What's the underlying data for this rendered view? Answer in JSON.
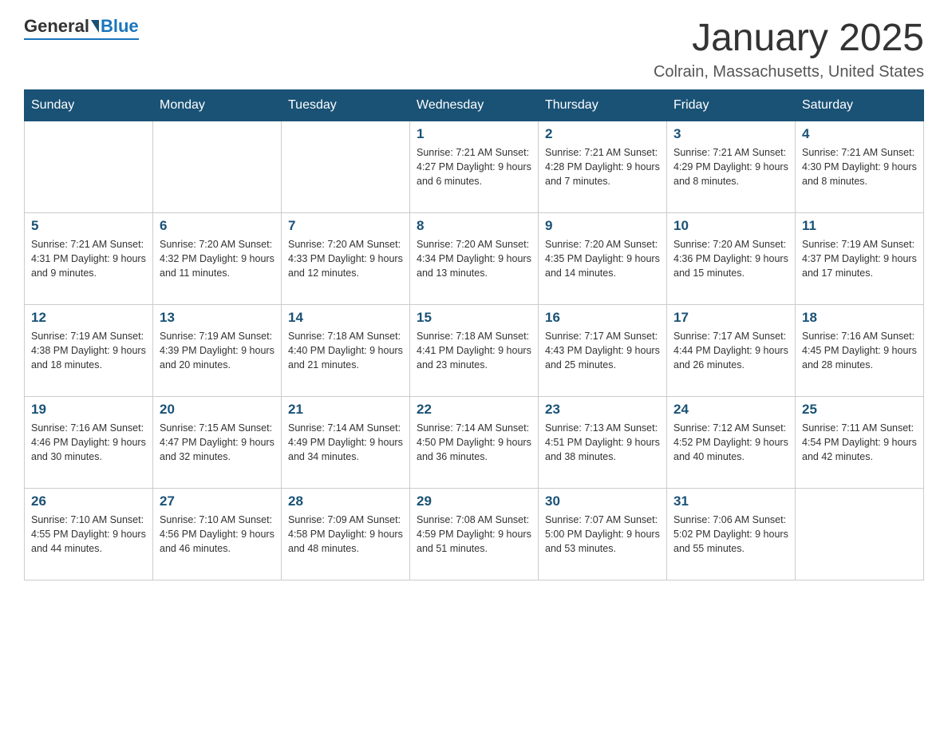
{
  "header": {
    "logo_general": "General",
    "logo_blue": "Blue",
    "month_title": "January 2025",
    "location": "Colrain, Massachusetts, United States"
  },
  "days_of_week": [
    "Sunday",
    "Monday",
    "Tuesday",
    "Wednesday",
    "Thursday",
    "Friday",
    "Saturday"
  ],
  "weeks": [
    [
      {
        "day": "",
        "info": ""
      },
      {
        "day": "",
        "info": ""
      },
      {
        "day": "",
        "info": ""
      },
      {
        "day": "1",
        "info": "Sunrise: 7:21 AM\nSunset: 4:27 PM\nDaylight: 9 hours and 6 minutes."
      },
      {
        "day": "2",
        "info": "Sunrise: 7:21 AM\nSunset: 4:28 PM\nDaylight: 9 hours and 7 minutes."
      },
      {
        "day": "3",
        "info": "Sunrise: 7:21 AM\nSunset: 4:29 PM\nDaylight: 9 hours and 8 minutes."
      },
      {
        "day": "4",
        "info": "Sunrise: 7:21 AM\nSunset: 4:30 PM\nDaylight: 9 hours and 8 minutes."
      }
    ],
    [
      {
        "day": "5",
        "info": "Sunrise: 7:21 AM\nSunset: 4:31 PM\nDaylight: 9 hours and 9 minutes."
      },
      {
        "day": "6",
        "info": "Sunrise: 7:20 AM\nSunset: 4:32 PM\nDaylight: 9 hours and 11 minutes."
      },
      {
        "day": "7",
        "info": "Sunrise: 7:20 AM\nSunset: 4:33 PM\nDaylight: 9 hours and 12 minutes."
      },
      {
        "day": "8",
        "info": "Sunrise: 7:20 AM\nSunset: 4:34 PM\nDaylight: 9 hours and 13 minutes."
      },
      {
        "day": "9",
        "info": "Sunrise: 7:20 AM\nSunset: 4:35 PM\nDaylight: 9 hours and 14 minutes."
      },
      {
        "day": "10",
        "info": "Sunrise: 7:20 AM\nSunset: 4:36 PM\nDaylight: 9 hours and 15 minutes."
      },
      {
        "day": "11",
        "info": "Sunrise: 7:19 AM\nSunset: 4:37 PM\nDaylight: 9 hours and 17 minutes."
      }
    ],
    [
      {
        "day": "12",
        "info": "Sunrise: 7:19 AM\nSunset: 4:38 PM\nDaylight: 9 hours and 18 minutes."
      },
      {
        "day": "13",
        "info": "Sunrise: 7:19 AM\nSunset: 4:39 PM\nDaylight: 9 hours and 20 minutes."
      },
      {
        "day": "14",
        "info": "Sunrise: 7:18 AM\nSunset: 4:40 PM\nDaylight: 9 hours and 21 minutes."
      },
      {
        "day": "15",
        "info": "Sunrise: 7:18 AM\nSunset: 4:41 PM\nDaylight: 9 hours and 23 minutes."
      },
      {
        "day": "16",
        "info": "Sunrise: 7:17 AM\nSunset: 4:43 PM\nDaylight: 9 hours and 25 minutes."
      },
      {
        "day": "17",
        "info": "Sunrise: 7:17 AM\nSunset: 4:44 PM\nDaylight: 9 hours and 26 minutes."
      },
      {
        "day": "18",
        "info": "Sunrise: 7:16 AM\nSunset: 4:45 PM\nDaylight: 9 hours and 28 minutes."
      }
    ],
    [
      {
        "day": "19",
        "info": "Sunrise: 7:16 AM\nSunset: 4:46 PM\nDaylight: 9 hours and 30 minutes."
      },
      {
        "day": "20",
        "info": "Sunrise: 7:15 AM\nSunset: 4:47 PM\nDaylight: 9 hours and 32 minutes."
      },
      {
        "day": "21",
        "info": "Sunrise: 7:14 AM\nSunset: 4:49 PM\nDaylight: 9 hours and 34 minutes."
      },
      {
        "day": "22",
        "info": "Sunrise: 7:14 AM\nSunset: 4:50 PM\nDaylight: 9 hours and 36 minutes."
      },
      {
        "day": "23",
        "info": "Sunrise: 7:13 AM\nSunset: 4:51 PM\nDaylight: 9 hours and 38 minutes."
      },
      {
        "day": "24",
        "info": "Sunrise: 7:12 AM\nSunset: 4:52 PM\nDaylight: 9 hours and 40 minutes."
      },
      {
        "day": "25",
        "info": "Sunrise: 7:11 AM\nSunset: 4:54 PM\nDaylight: 9 hours and 42 minutes."
      }
    ],
    [
      {
        "day": "26",
        "info": "Sunrise: 7:10 AM\nSunset: 4:55 PM\nDaylight: 9 hours and 44 minutes."
      },
      {
        "day": "27",
        "info": "Sunrise: 7:10 AM\nSunset: 4:56 PM\nDaylight: 9 hours and 46 minutes."
      },
      {
        "day": "28",
        "info": "Sunrise: 7:09 AM\nSunset: 4:58 PM\nDaylight: 9 hours and 48 minutes."
      },
      {
        "day": "29",
        "info": "Sunrise: 7:08 AM\nSunset: 4:59 PM\nDaylight: 9 hours and 51 minutes."
      },
      {
        "day": "30",
        "info": "Sunrise: 7:07 AM\nSunset: 5:00 PM\nDaylight: 9 hours and 53 minutes."
      },
      {
        "day": "31",
        "info": "Sunrise: 7:06 AM\nSunset: 5:02 PM\nDaylight: 9 hours and 55 minutes."
      },
      {
        "day": "",
        "info": ""
      }
    ]
  ]
}
